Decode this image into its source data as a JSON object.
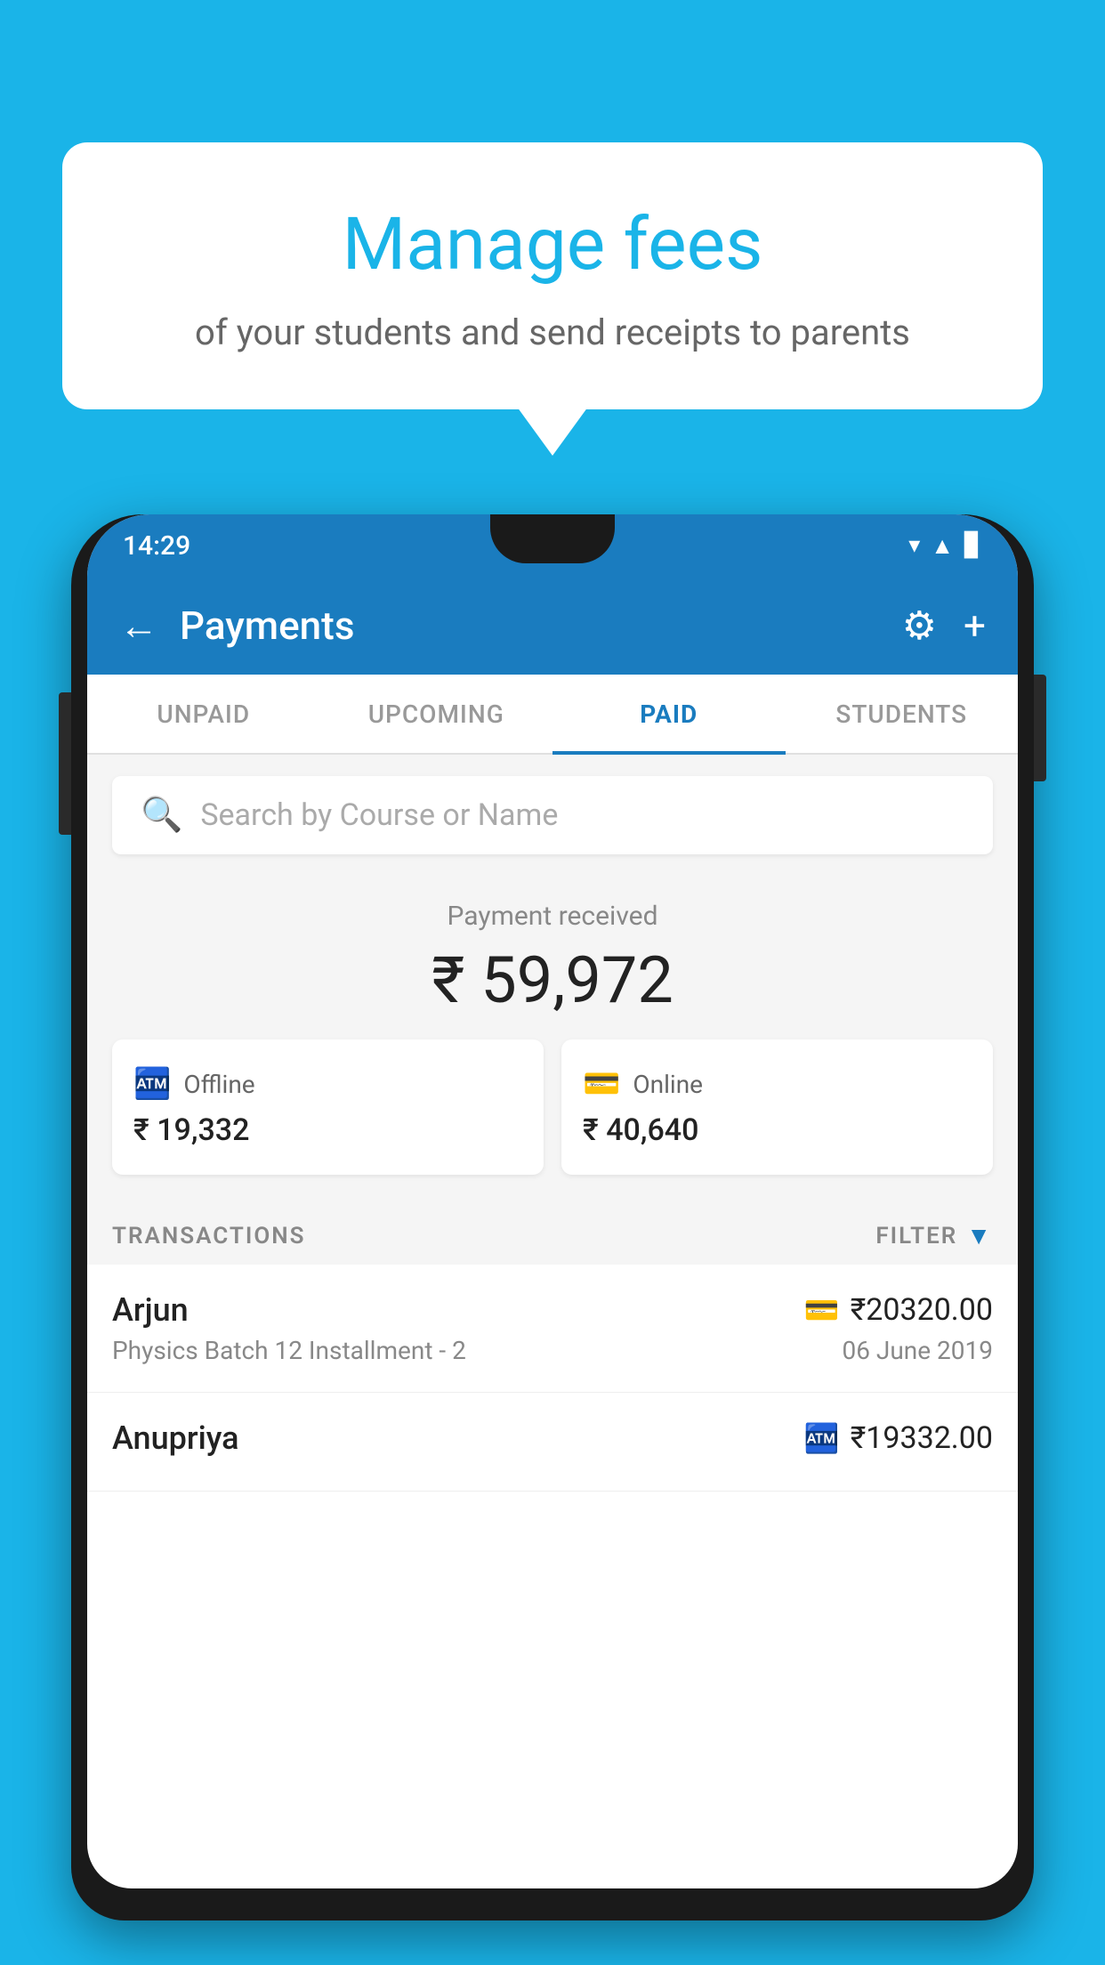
{
  "background_color": "#1ab4e8",
  "speech_bubble": {
    "title": "Manage fees",
    "subtitle": "of your students and send receipts to parents"
  },
  "status_bar": {
    "time": "14:29",
    "icons": [
      "▼",
      "▲",
      "▊"
    ]
  },
  "app_bar": {
    "title": "Payments",
    "back_label": "←",
    "settings_label": "⚙",
    "add_label": "+"
  },
  "tabs": [
    {
      "id": "unpaid",
      "label": "UNPAID",
      "active": false
    },
    {
      "id": "upcoming",
      "label": "UPCOMING",
      "active": false
    },
    {
      "id": "paid",
      "label": "PAID",
      "active": true
    },
    {
      "id": "students",
      "label": "STUDENTS",
      "active": false
    }
  ],
  "search": {
    "placeholder": "Search by Course or Name"
  },
  "payment_summary": {
    "label": "Payment received",
    "amount": "₹ 59,972"
  },
  "payment_cards": [
    {
      "id": "offline",
      "label": "Offline",
      "amount": "₹ 19,332",
      "icon": "💳"
    },
    {
      "id": "online",
      "label": "Online",
      "amount": "₹ 40,640",
      "icon": "💳"
    }
  ],
  "transactions_header": {
    "label": "TRANSACTIONS",
    "filter_label": "FILTER"
  },
  "transactions": [
    {
      "name": "Arjun",
      "amount": "₹20320.00",
      "method": "online",
      "details": "Physics Batch 12 Installment - 2",
      "date": "06 June 2019"
    },
    {
      "name": "Anupriya",
      "amount": "₹19332.00",
      "method": "offline",
      "details": "",
      "date": ""
    }
  ]
}
